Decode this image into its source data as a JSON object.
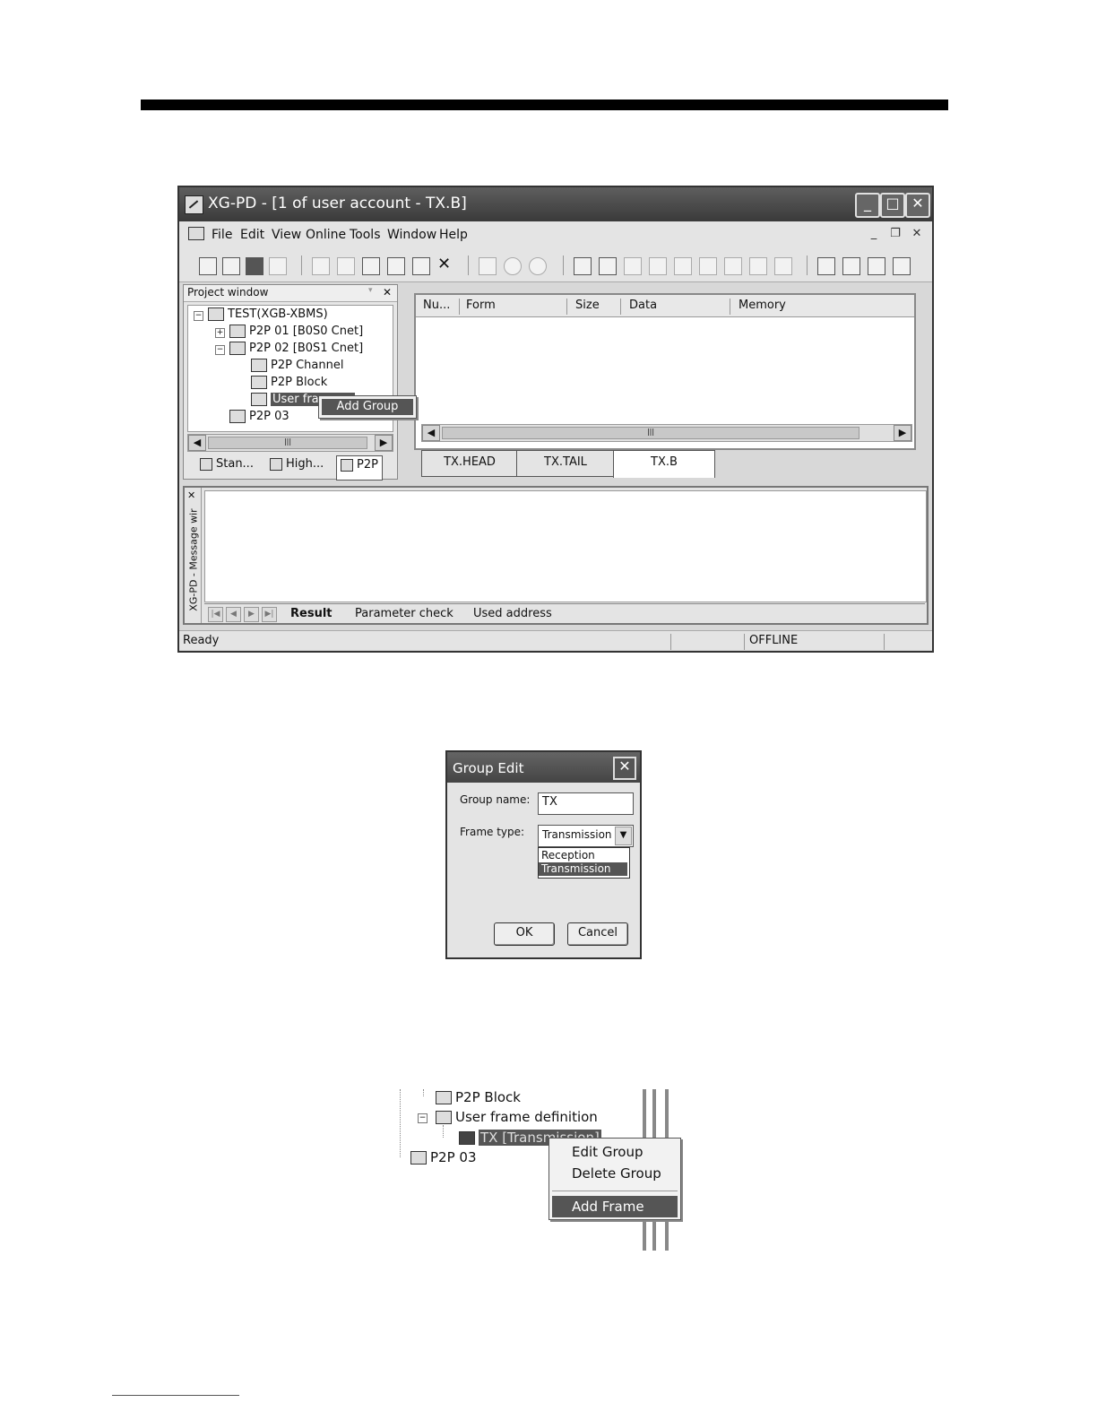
{
  "window": {
    "title": "XG-PD - [1 of user account - TX.B]",
    "menu": [
      "File",
      "Edit",
      "View",
      "Online",
      "Tools",
      "Window",
      "Help"
    ],
    "project_window": {
      "title": "Project window",
      "tree": {
        "root": "TEST(XGB-XBMS)",
        "p2p01": "P2P 01 [B0S0 Cnet]",
        "p2p02": "P2P 02 [B0S1 Cnet]",
        "channel": "P2P Channel",
        "block": "P2P Block",
        "userframe": "User fra",
        "p2p03": "P2P 03"
      },
      "tabs": [
        "Stan...",
        "High...",
        "P2P"
      ]
    },
    "context_menu": {
      "add_group": "Add Group"
    },
    "list": {
      "columns": [
        "Nu...",
        "Form",
        "Size",
        "Data",
        "Memory"
      ]
    },
    "doc_tabs": [
      "TX.HEAD",
      "TX.TAIL",
      "TX.B"
    ],
    "message_window": {
      "title": "XG-PD - Message wir",
      "tabs": [
        "Result",
        "Parameter check",
        "Used address"
      ]
    },
    "status": {
      "left": "Ready",
      "mode": "OFFLINE"
    }
  },
  "dialog": {
    "title": "Group Edit",
    "group_name_label": "Group name:",
    "group_name_value": "TX",
    "frame_type_label": "Frame type:",
    "frame_type_value": "Transmission",
    "options": [
      "Reception",
      "Transmission"
    ],
    "ok": "OK",
    "cancel": "Cancel"
  },
  "tree_crop": {
    "block": "P2P Block",
    "userframe": "User frame definition",
    "tx": "TX  [Transmission]",
    "p2p03": "P2P 03",
    "menu": {
      "edit_group": "Edit Group",
      "delete_group": "Delete Group",
      "add_frame": "Add Frame"
    }
  }
}
